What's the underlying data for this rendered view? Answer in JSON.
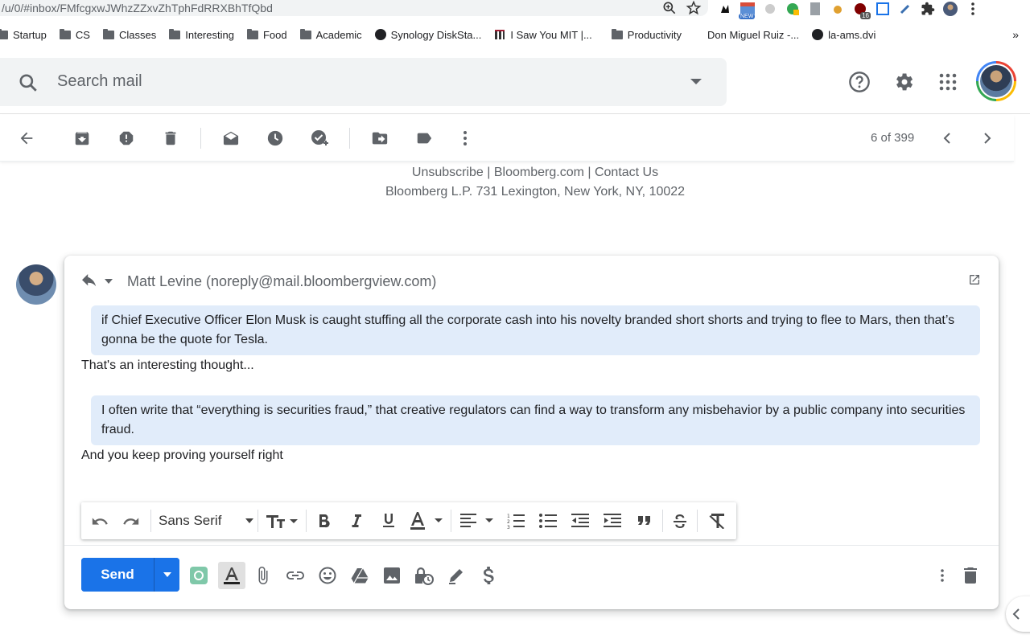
{
  "browser": {
    "url": "/u/0/#inbox/FMfcgxwJWhzZZxvZhTphFdRRXBhTfQbd",
    "extension_badges": {
      "new": "NEW",
      "count": "16"
    },
    "bookmarks": [
      {
        "label": "Startup",
        "icon": "folder-icon"
      },
      {
        "label": "CS",
        "icon": "folder-icon"
      },
      {
        "label": "Classes",
        "icon": "folder-icon"
      },
      {
        "label": "Interesting",
        "icon": "folder-icon"
      },
      {
        "label": "Food",
        "icon": "folder-icon"
      },
      {
        "label": "Academic",
        "icon": "folder-icon"
      },
      {
        "label": "Synology DiskSta...",
        "icon": "globe-icon"
      },
      {
        "label": "I Saw You MIT |...",
        "icon": "mit-icon"
      },
      {
        "label": "Productivity",
        "icon": "folder-icon"
      },
      {
        "label": "Don Miguel Ruiz -...",
        "icon": "none"
      },
      {
        "label": "la-ams.dvi",
        "icon": "globe-icon"
      }
    ],
    "more_bookmarks": "»"
  },
  "gmail": {
    "search": {
      "placeholder": "Search mail"
    },
    "toolbar": {
      "pager": "6 of 399"
    },
    "footer": {
      "links": "Unsubscribe | Bloomberg.com | Contact Us",
      "address": "Bloomberg L.P. 731 Lexington, New York, NY, 10022"
    },
    "reply": {
      "recipient": "Matt Levine (noreply@mail.bloombergview.com)",
      "quote1": "if Chief Executive Officer Elon Musk is caught stuffing all the corporate cash into his novelty branded short shorts and trying to flee to Mars, then that’s gonna be the quote for Tesla.",
      "response1": "That's an interesting thought...",
      "quote2": "I often write that “everything is securities fraud,” that creative regulators can find a way to transform any misbehavior by a public company into securities fraud.",
      "response2": "And you keep proving yourself right"
    },
    "format_bar": {
      "font": "Sans Serif"
    },
    "send_label": "Send"
  },
  "colors": {
    "send": "#1a73e8",
    "quote_bg": "#e1ecfa",
    "accent_green": "#34a853"
  }
}
